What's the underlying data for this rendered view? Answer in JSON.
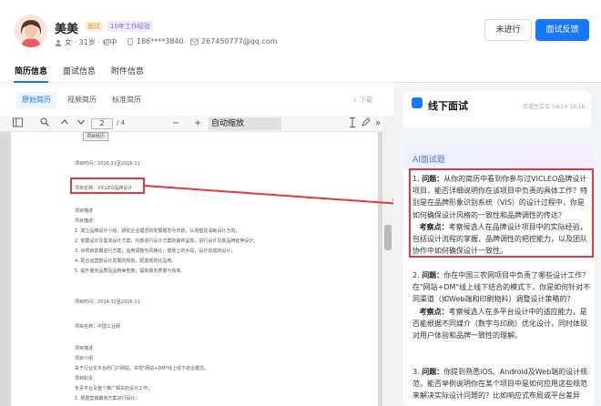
{
  "profile": {
    "name": "美美",
    "tag_test": "面试",
    "tag_exp": "10年工作经验",
    "basic": "女 · 31岁 · 初中",
    "phone": "186****3840",
    "email": "267450777@qq.com"
  },
  "actions": {
    "pending": "未进行",
    "feedback": "面试反馈"
  },
  "tabs": [
    "简历信息",
    "面试信息",
    "附件信息"
  ],
  "resume_tabs": [
    "原始简历",
    "视频简历",
    "标准简历"
  ],
  "download_label": "↓ 下载",
  "pdf_toolbar": {
    "page": "2",
    "page_total": "/ 4",
    "zoom": "自动缩放"
  },
  "document": {
    "box_label": "项目经历",
    "lines": [
      "项目时间：2016-11至2016-11",
      "项目名称：VICLEO品牌设计",
      "项目描述",
      "项目描述：",
      "1. 成立品牌设计小组，研究企业理念的发展概念与背景，从而塑造清晰设计方向；",
      "2. 依据设计及需求设计方案，内部进行设计方案的最终呈现，进行设计及其品牌延伸设计；",
      "3. 对项目前期进行方案，运用调整与风格化，借助上的手段，设计完成的设计；",
      "4. 配合运营部设计发展的规划，配置规则化品牌。",
      "5. 提升服务品质及品牌美誉度，提高服务质量与效率。",
      "",
      "项目时间：2014-12至2016-11",
      "",
      "项目名称：中国工业网",
      "",
      "项目描述",
      "项目介绍",
      "关于行业化平台的门户网站，实现\"网站+DM\"线上线下结合模式。",
      "项目职责：",
      "负责平台及整个推广相关的设计工作；",
      "1. 根据营销策划方案进行设计。"
    ]
  },
  "offline": {
    "title": "线下面试",
    "meta": "合道生立合 04/24 18:16"
  },
  "ai": {
    "title": "AI面试题",
    "questions": [
      {
        "num": "1.",
        "q_label": "问题：",
        "q": "从你的简历中看到你参与过VICLEO品牌设计项目，能否详细说明你在该项目中负责的具体工作？特别是在品牌形象识别系统（VIS）的设计过程中，你是如何确保设计风格的一致性和品牌调性的传达？",
        "p_label": "考察点：",
        "p": "考察候选人在品牌设计项目中的实际经验，包括设计流程的掌握、品牌调性的把控能力，以及团队协作中如何确保设计一致性。"
      },
      {
        "num": "2.",
        "q_label": "问题：",
        "q": "你在中国三农网项目中负责了哪些设计工作？在\"网站+DM\"线上线下结合的模式下，你是如何针对不同渠道（如Web端和印刷物料）调整设计策略的？",
        "p_label": "考察点：",
        "p": "考察候选人在多平台设计中的适应能力，是否能根据不同媒介（数字与印刷）优化设计，同时体现对用户体验和品牌一致性的理解。"
      },
      {
        "num": "3.",
        "q_label": "问题：",
        "q": "你提到熟悉iOS、Android及Web端的设计规范，能否举例说明你在某个项目中是如何应用这些规范来解决实际设计问题的？比如响应式布局或平台差异",
        "p_label": "",
        "p": ""
      }
    ]
  },
  "colors": {
    "primary": "#1677ff",
    "highlight": "#e23a3a",
    "ai_title": "#4a6cf7"
  }
}
